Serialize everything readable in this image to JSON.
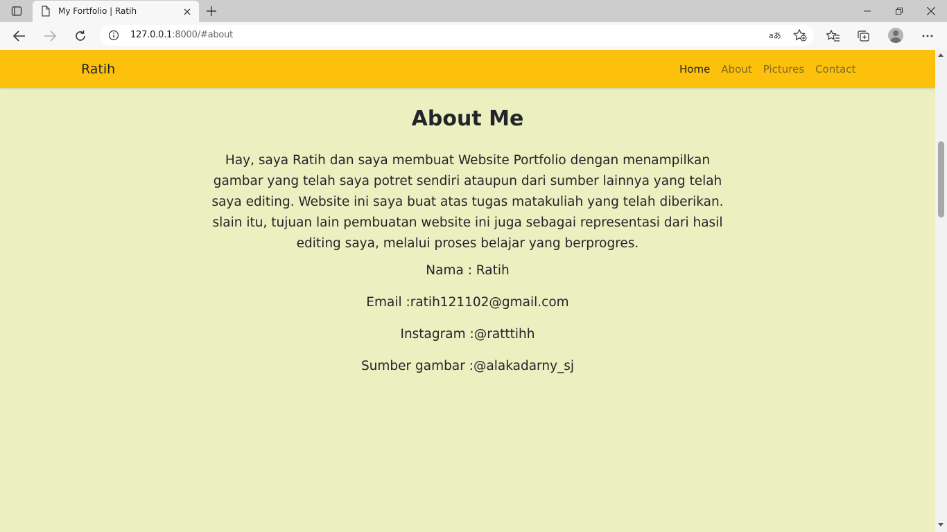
{
  "browser": {
    "tab_title": "My Fortfolio | Ratih",
    "url_host": "127.0.0.1",
    "url_path": ":8000/#about"
  },
  "page": {
    "brand": "Ratih",
    "nav": [
      "Home",
      "About",
      "Pictures",
      "Contact"
    ],
    "heading": "About Me",
    "intro": "Hay, saya Ratih dan saya membuat Website Portfolio dengan menampilkan gambar yang telah saya potret sendiri ataupun dari sumber lainnya yang telah saya editing. Website ini saya buat atas tugas matakuliah yang telah diberikan. slain itu, tujuan lain pembuatan website ini juga sebagai representasi dari hasil editing saya, melalui proses belajar yang berprogres.",
    "nama": "Nama : Ratih",
    "email": "Email :ratih121102@gmail.com",
    "instagram": "Instagram :@ratttihh",
    "sumber": "Sumber gambar :@alakadarny_sj"
  },
  "colors": {
    "navbar": "#fdc10b",
    "background": "#ecefbf"
  }
}
